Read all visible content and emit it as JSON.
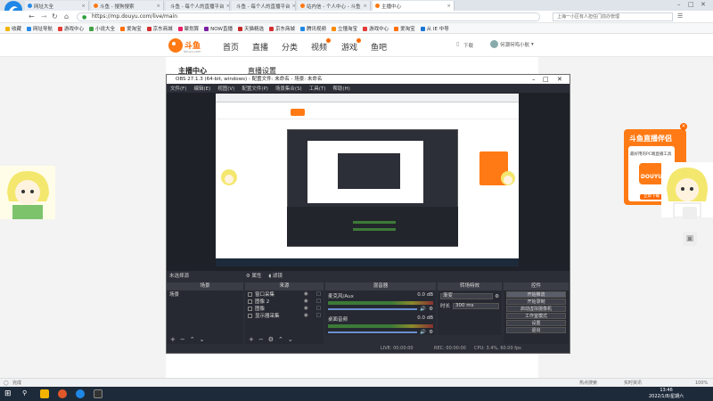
{
  "browser": {
    "tabs": [
      {
        "label": "网址大全",
        "active": false
      },
      {
        "label": "斗鱼 - 搜狗搜索",
        "active": false
      },
      {
        "label": "斗鱼 - 每个人的直播平台",
        "active": false
      },
      {
        "label": "斗鱼 - 每个人的直播平台",
        "active": false
      },
      {
        "label": "站内信 - 个人中心 - 斗鱼",
        "active": false
      },
      {
        "label": "主播中心",
        "active": true
      }
    ],
    "url": "https://mp.douyu.com/live/main",
    "search_text": "上海一小区有人担任门前办管理",
    "bookmarks": [
      {
        "label": "收藏",
        "color": "#f2b400"
      },
      {
        "label": "网址导航",
        "color": "#2b8ae6"
      },
      {
        "label": "游戏中心",
        "color": "#e53935"
      },
      {
        "label": "小说大全",
        "color": "#43a047"
      },
      {
        "label": "爱淘宝",
        "color": "#ff6f00"
      },
      {
        "label": "京东商城",
        "color": "#d32f2f"
      },
      {
        "label": "聚划算",
        "color": "#e91e63"
      },
      {
        "label": "NOW直播",
        "color": "#7b1fa2"
      },
      {
        "label": "天猫精选",
        "color": "#c62828"
      },
      {
        "label": "京东商城",
        "color": "#d32f2f"
      },
      {
        "label": "腾讯视频",
        "color": "#1e88e5"
      },
      {
        "label": "立懂淘宝",
        "color": "#fb8c00"
      },
      {
        "label": "游戏中心",
        "color": "#e53935"
      },
      {
        "label": "爱淘宝",
        "color": "#ff6f00"
      },
      {
        "label": "从 IE 中导",
        "color": "#1976d2"
      }
    ],
    "status_left": "完成",
    "status_items": [
      "热点搜索",
      "实时资讯",
      "100%"
    ],
    "clock": {
      "time": "13:46",
      "date": "2022/1/8/星期六"
    }
  },
  "site": {
    "logo_text": "斗鱼",
    "logo_sub": "douyu.com",
    "nav": [
      {
        "label": "首页",
        "badge": false
      },
      {
        "label": "直播",
        "badge": false
      },
      {
        "label": "分类",
        "badge": false
      },
      {
        "label": "视频",
        "badge": true
      },
      {
        "label": "游戏",
        "badge": true
      },
      {
        "label": "鱼吧",
        "badge": false
      }
    ],
    "download": "下载",
    "username": "何潮何鸣小航",
    "side_title": "主播中心",
    "main_title": "直播设置"
  },
  "obs": {
    "title": "OBS 27.1.3 (64-bit, windows) - 配置文件: 未命名 - 场景: 未命名",
    "menu": [
      "文件(F)",
      "编辑(E)",
      "视图(V)",
      "配置文件(P)",
      "场景集合(S)",
      "工具(T)",
      "帮助(H)"
    ],
    "below_preview_label": "未选择源",
    "prop_btn": "属性",
    "filter_btn": "滤镜",
    "scenes_header": "场景",
    "scenes": [
      "场景"
    ],
    "sources_header": "来源",
    "sources": [
      "窗口采集",
      "图像 2",
      "图像",
      "显示器采集"
    ],
    "mixer_header": "混音器",
    "mixer": [
      {
        "name": "麦克风/Aux",
        "db": "0.0 dB"
      },
      {
        "name": "桌面音频",
        "db": "0.0 dB"
      }
    ],
    "transitions_header": "转场特效",
    "transition": "渐变",
    "duration_label": "时长",
    "duration": "300 ms",
    "controls_header": "控件",
    "controls": [
      "开始推流",
      "开始录制",
      "启动虚拟摄像机",
      "工作室模式",
      "设置",
      "退出"
    ],
    "status": [
      "LIVE: 00:00:00",
      "REC: 00:00:00",
      "CPU: 3.4%, 60.00 fps"
    ]
  },
  "promo": {
    "title": "斗鱼直播伴侣",
    "desc": "最好用的PC端直播工具",
    "logo": "DOUYU",
    "button": "立即下载"
  }
}
